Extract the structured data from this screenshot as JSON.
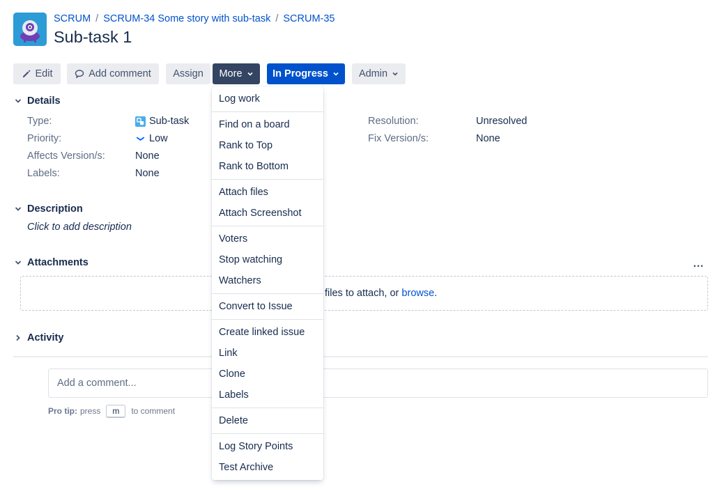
{
  "breadcrumb": {
    "project": "SCRUM",
    "parent": "SCRUM-34 Some story with sub-task",
    "issue": "SCRUM-35",
    "separator": "/"
  },
  "title": "Sub-task 1",
  "toolbar": {
    "edit": "Edit",
    "add_comment": "Add comment",
    "assign": "Assign",
    "more": "More",
    "status": "In Progress",
    "admin": "Admin"
  },
  "details": {
    "heading": "Details",
    "type_label": "Type:",
    "type_value": "Sub-task",
    "priority_label": "Priority:",
    "priority_value": "Low",
    "affects_label": "Affects Version/s:",
    "affects_value": "None",
    "labels_label": "Labels:",
    "labels_value": "None",
    "resolution_label": "Resolution:",
    "resolution_value": "Unresolved",
    "fix_label": "Fix Version/s:",
    "fix_value": "None"
  },
  "description": {
    "heading": "Description",
    "placeholder": "Click to add description"
  },
  "attachments": {
    "heading": "Attachments",
    "drop_text": "files to attach, or ",
    "browse": "browse",
    "period": ".",
    "more_icon": "…"
  },
  "activity": {
    "heading": "Activity",
    "comment_placeholder": "Add a comment...",
    "protip_label": "Pro tip:",
    "protip_press": "press",
    "protip_key": "m",
    "protip_suffix": "to comment"
  },
  "menu": {
    "items": [
      "Log work",
      "Find on a board",
      "Rank to Top",
      "Rank to Bottom",
      "Attach files",
      "Attach Screenshot",
      "Voters",
      "Stop watching",
      "Watchers",
      "Convert to Issue",
      "Create linked issue",
      "Link",
      "Clone",
      "Labels",
      "Delete",
      "Log Story Points",
      "Test Archive"
    ]
  },
  "colors": {
    "link": "#0052cc",
    "primary": "#0052cc",
    "dark_button": "#344563",
    "button_bg": "#ebecf0",
    "avatar_bg": "#2d9bd6"
  }
}
